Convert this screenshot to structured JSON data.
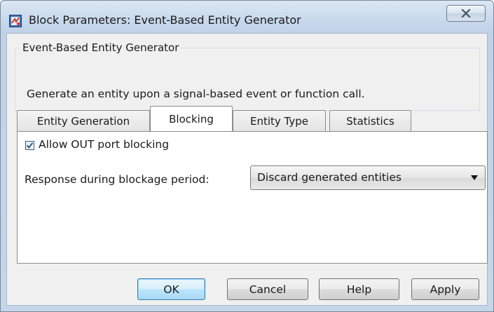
{
  "window": {
    "title": "Block Parameters: Event-Based Entity Generator",
    "close_icon": "close-icon"
  },
  "group": {
    "title": "Event-Based Entity Generator",
    "description": "Generate an entity upon a signal-based event or function call."
  },
  "tabs": [
    {
      "label": "Entity Generation",
      "active": false
    },
    {
      "label": "Blocking",
      "active": true
    },
    {
      "label": "Entity Type",
      "active": false
    },
    {
      "label": "Statistics",
      "active": false
    }
  ],
  "blocking": {
    "allow_out_port_blocking": {
      "label": "Allow OUT port blocking",
      "checked": true
    },
    "response": {
      "label": "Response during blockage period:",
      "selected": "Discard generated entities"
    }
  },
  "buttons": {
    "ok": "OK",
    "cancel": "Cancel",
    "help": "Help",
    "apply": "Apply"
  },
  "colors": {
    "titlebar": "#c7d8ec",
    "dialog_bg": "#f0f0f0",
    "default_button_border": "#3c7fb1",
    "checkmark": "#2d5a8a"
  }
}
